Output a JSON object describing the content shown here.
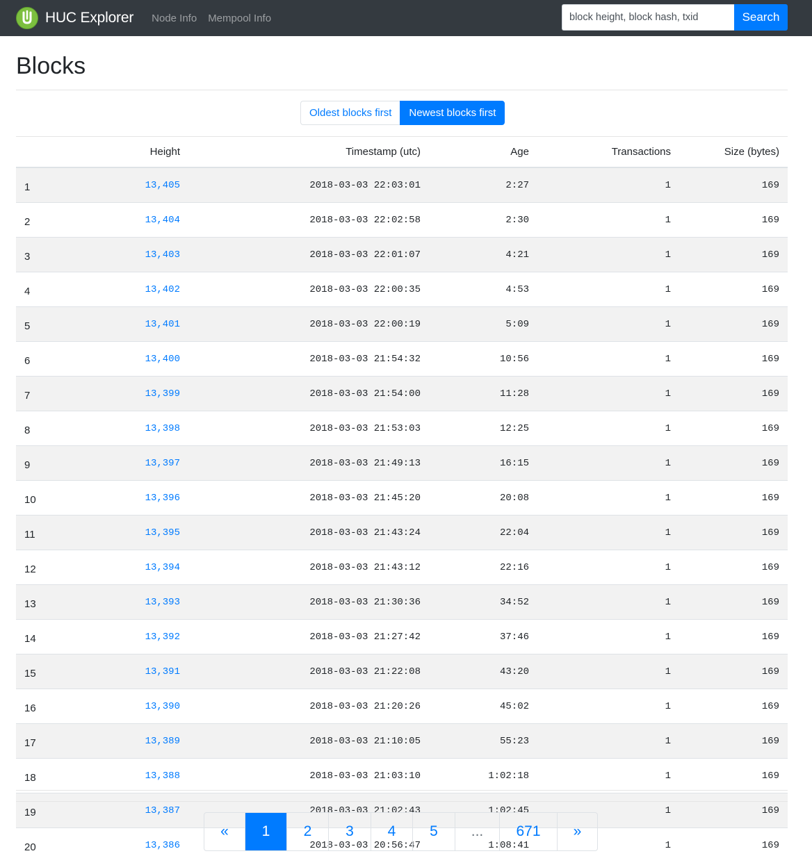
{
  "nav": {
    "brand": "HUC Explorer",
    "links": [
      "Node Info",
      "Mempool Info"
    ],
    "search_placeholder": "block height, block hash, txid",
    "search_label": "Search"
  },
  "page": {
    "title": "Blocks",
    "sort_oldest": "Oldest blocks first",
    "sort_newest": "Newest blocks first",
    "sort_active": "newest"
  },
  "table": {
    "headers": [
      "",
      "Height",
      "Timestamp (utc)",
      "Age",
      "Transactions",
      "Size (bytes)"
    ],
    "rows": [
      {
        "idx": "1",
        "height": "13,405",
        "timestamp": "2018-03-03 22:03:01",
        "age": "2:27",
        "tx": "1",
        "size": "169"
      },
      {
        "idx": "2",
        "height": "13,404",
        "timestamp": "2018-03-03 22:02:58",
        "age": "2:30",
        "tx": "1",
        "size": "169"
      },
      {
        "idx": "3",
        "height": "13,403",
        "timestamp": "2018-03-03 22:01:07",
        "age": "4:21",
        "tx": "1",
        "size": "169"
      },
      {
        "idx": "4",
        "height": "13,402",
        "timestamp": "2018-03-03 22:00:35",
        "age": "4:53",
        "tx": "1",
        "size": "169"
      },
      {
        "idx": "5",
        "height": "13,401",
        "timestamp": "2018-03-03 22:00:19",
        "age": "5:09",
        "tx": "1",
        "size": "169"
      },
      {
        "idx": "6",
        "height": "13,400",
        "timestamp": "2018-03-03 21:54:32",
        "age": "10:56",
        "tx": "1",
        "size": "169"
      },
      {
        "idx": "7",
        "height": "13,399",
        "timestamp": "2018-03-03 21:54:00",
        "age": "11:28",
        "tx": "1",
        "size": "169"
      },
      {
        "idx": "8",
        "height": "13,398",
        "timestamp": "2018-03-03 21:53:03",
        "age": "12:25",
        "tx": "1",
        "size": "169"
      },
      {
        "idx": "9",
        "height": "13,397",
        "timestamp": "2018-03-03 21:49:13",
        "age": "16:15",
        "tx": "1",
        "size": "169"
      },
      {
        "idx": "10",
        "height": "13,396",
        "timestamp": "2018-03-03 21:45:20",
        "age": "20:08",
        "tx": "1",
        "size": "169"
      },
      {
        "idx": "11",
        "height": "13,395",
        "timestamp": "2018-03-03 21:43:24",
        "age": "22:04",
        "tx": "1",
        "size": "169"
      },
      {
        "idx": "12",
        "height": "13,394",
        "timestamp": "2018-03-03 21:43:12",
        "age": "22:16",
        "tx": "1",
        "size": "169"
      },
      {
        "idx": "13",
        "height": "13,393",
        "timestamp": "2018-03-03 21:30:36",
        "age": "34:52",
        "tx": "1",
        "size": "169"
      },
      {
        "idx": "14",
        "height": "13,392",
        "timestamp": "2018-03-03 21:27:42",
        "age": "37:46",
        "tx": "1",
        "size": "169"
      },
      {
        "idx": "15",
        "height": "13,391",
        "timestamp": "2018-03-03 21:22:08",
        "age": "43:20",
        "tx": "1",
        "size": "169"
      },
      {
        "idx": "16",
        "height": "13,390",
        "timestamp": "2018-03-03 21:20:26",
        "age": "45:02",
        "tx": "1",
        "size": "169"
      },
      {
        "idx": "17",
        "height": "13,389",
        "timestamp": "2018-03-03 21:10:05",
        "age": "55:23",
        "tx": "1",
        "size": "169"
      },
      {
        "idx": "18",
        "height": "13,388",
        "timestamp": "2018-03-03 21:03:10",
        "age": "1:02:18",
        "tx": "1",
        "size": "169"
      },
      {
        "idx": "19",
        "height": "13,387",
        "timestamp": "2018-03-03 21:02:43",
        "age": "1:02:45",
        "tx": "1",
        "size": "169"
      },
      {
        "idx": "20",
        "height": "13,386",
        "timestamp": "2018-03-03 20:56:47",
        "age": "1:08:41",
        "tx": "1",
        "size": "169"
      }
    ]
  },
  "pagination": {
    "items": [
      {
        "label": "«",
        "state": "normal"
      },
      {
        "label": "1",
        "state": "active"
      },
      {
        "label": "2",
        "state": "normal"
      },
      {
        "label": "3",
        "state": "normal"
      },
      {
        "label": "4",
        "state": "normal"
      },
      {
        "label": "5",
        "state": "normal"
      },
      {
        "label": "...",
        "state": "disabled"
      },
      {
        "label": "671",
        "state": "normal"
      },
      {
        "label": "»",
        "state": "normal"
      }
    ]
  },
  "colors": {
    "navbar": "#343a40",
    "primary": "#007bff",
    "logo": "#7cbf3f"
  },
  "icons": {
    "brand_logo": "huc-logo-icon"
  }
}
